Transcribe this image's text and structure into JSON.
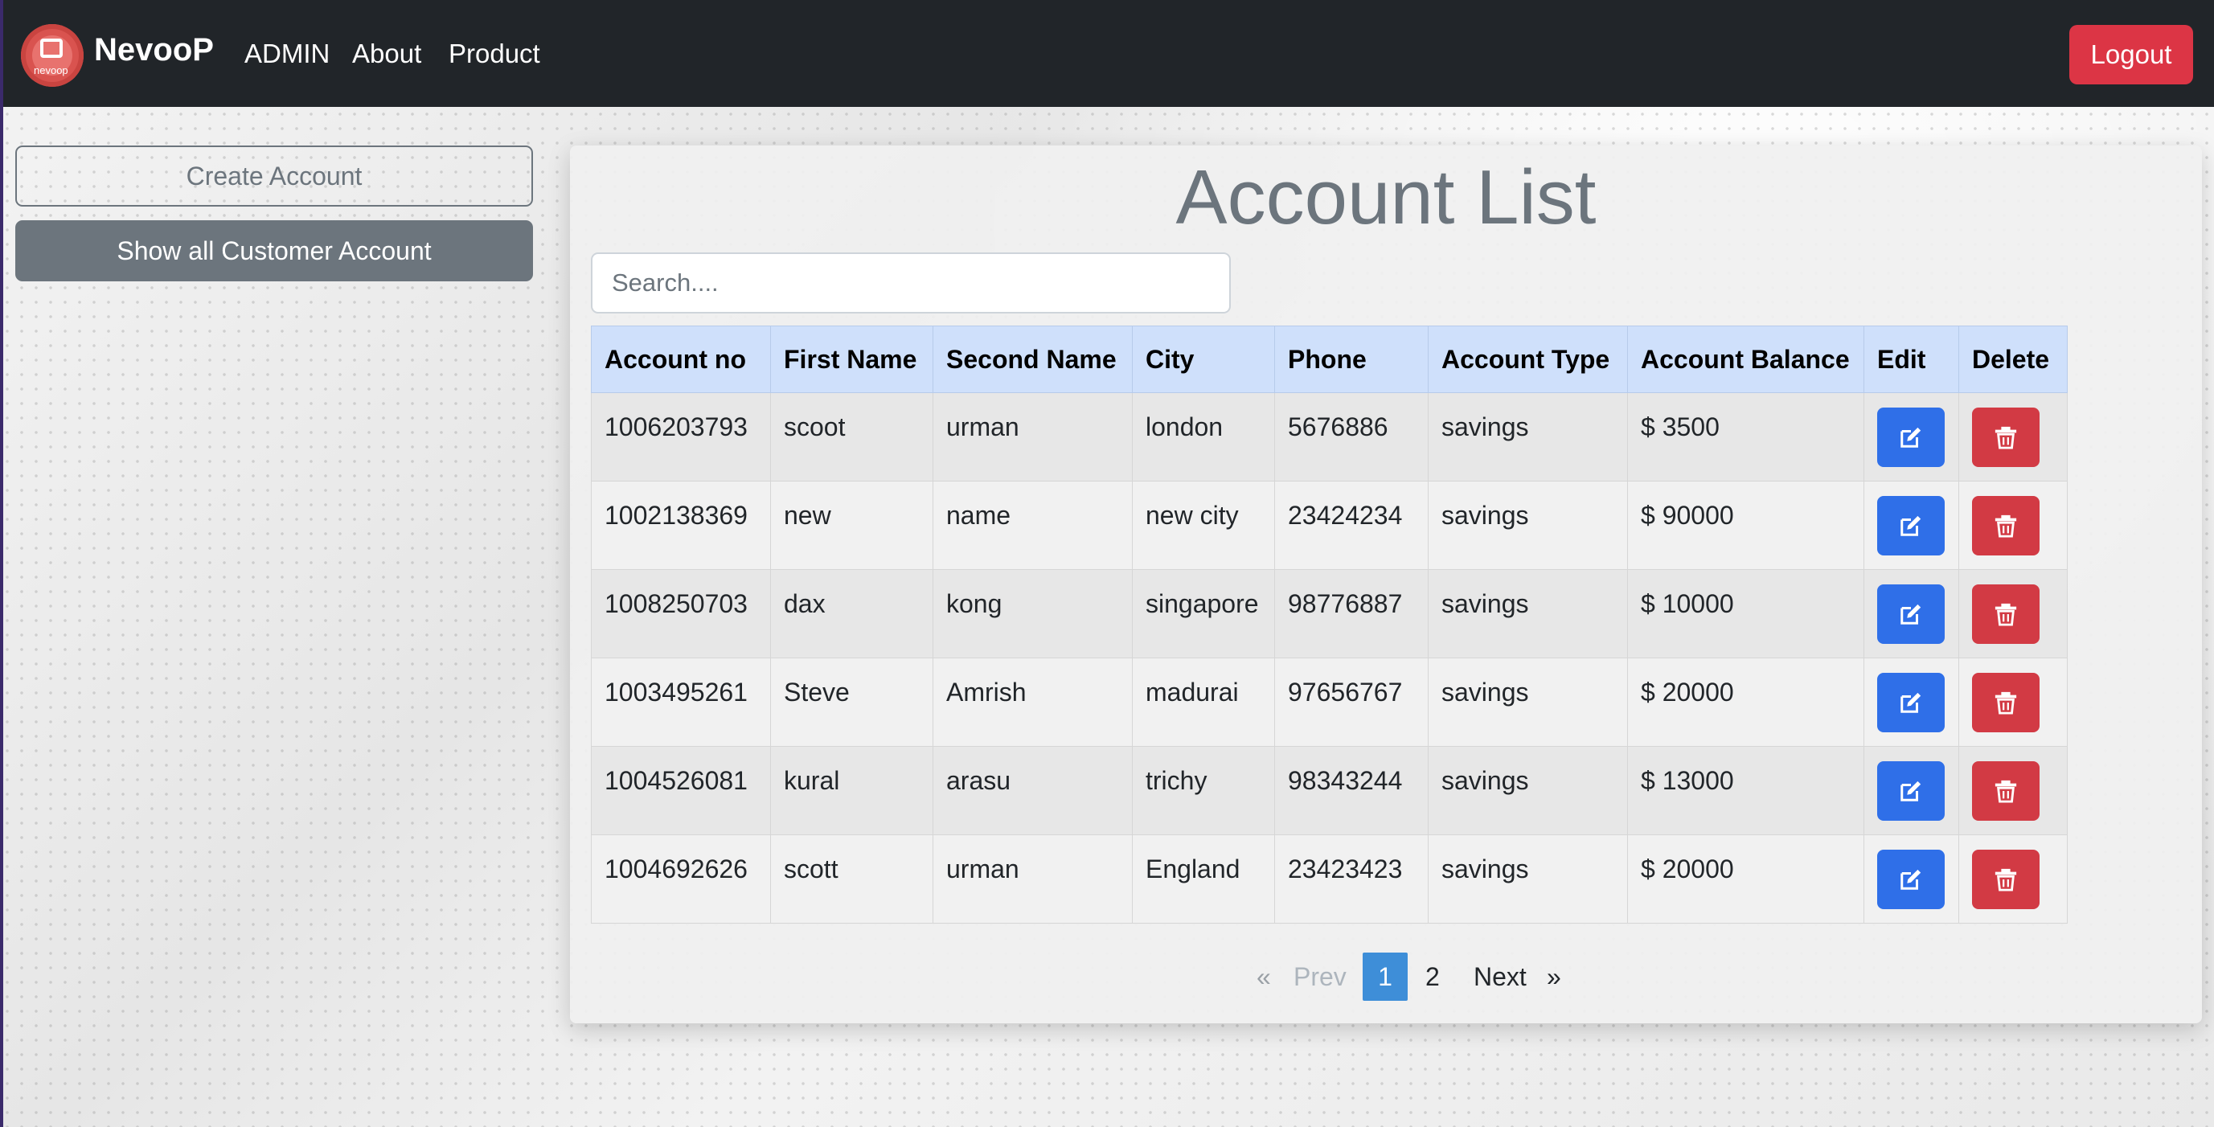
{
  "navbar": {
    "brand": "NevooP",
    "logo_text": "nevoop",
    "links": [
      "ADMIN",
      "About",
      "Product"
    ],
    "logout_label": "Logout"
  },
  "sidebar": {
    "create_label": "Create Account",
    "show_all_label": "Show all Customer Account"
  },
  "main": {
    "title": "Account List",
    "search_placeholder": "Search....",
    "columns": [
      "Account no",
      "First Name",
      "Second Name",
      "City",
      "Phone",
      "Account Type",
      "Account Balance",
      "Edit",
      "Delete"
    ],
    "rows": [
      [
        "1006203793",
        "scoot",
        "urman",
        "london",
        "5676886",
        "savings",
        "$ 3500"
      ],
      [
        "1002138369",
        "new",
        "name",
        "new city",
        "23424234",
        "savings",
        "$ 90000"
      ],
      [
        "1008250703",
        "dax",
        "kong",
        "singapore",
        "98776887",
        "savings",
        "$ 10000"
      ],
      [
        "1003495261",
        "Steve",
        "Amrish",
        "madurai",
        "97656767",
        "savings",
        "$ 20000"
      ],
      [
        "1004526081",
        "kural",
        "arasu",
        "trichy",
        "98343244",
        "savings",
        "$ 13000"
      ],
      [
        "1004692626",
        "scott",
        "urman",
        "England",
        "23423423",
        "savings",
        "$ 20000"
      ]
    ],
    "edit_icon": "edit-icon",
    "delete_icon": "trash-icon"
  },
  "pagination": {
    "prev_arrow": "«",
    "prev_label": "Prev",
    "pages": [
      "1",
      "2"
    ],
    "current_page": "1",
    "next_label": "Next",
    "next_arrow": "»"
  },
  "colors": {
    "navbar": "#212529",
    "danger": "#dc3545",
    "primary": "#2f6fe8",
    "secondary": "#6c757d",
    "table_header": "#cfe0fb",
    "active_page": "#3e8ed8"
  }
}
